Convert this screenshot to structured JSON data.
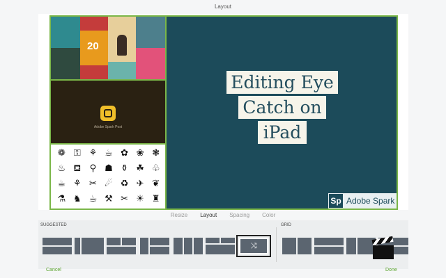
{
  "header": {
    "title": "Layout"
  },
  "canvas": {
    "collage_top": {
      "tiles": [
        {
          "text": "",
          "color": "#2f8a8f"
        },
        {
          "text": "",
          "color": "#c43c3b"
        },
        {
          "text": "",
          "color": "#4d7f8c"
        },
        {
          "text": "20",
          "color": "#e89a1d"
        },
        {
          "text": "",
          "color": "#e7cf9b"
        },
        {
          "text": "",
          "color": "#6bb3ab"
        },
        {
          "text": "",
          "color": "#2f4a3f"
        },
        {
          "text": "",
          "color": "#e2527a"
        }
      ]
    },
    "post_cell": {
      "label": "Adobe Spark Post"
    },
    "icon_cell": {
      "icons": [
        "❁",
        "⚿",
        "⚘",
        "☕",
        "✿",
        "❀",
        "❃",
        "♨",
        "⛾",
        "⚲",
        "☗",
        "⚱",
        "☘",
        "♧",
        "☕",
        "⚘",
        "✂",
        "☄",
        "♻",
        "✈",
        "❦",
        "⚗",
        "♞",
        "☕",
        "⚒",
        "✂",
        "☀",
        "♜"
      ]
    },
    "headline": {
      "line1": "Editing Eye",
      "line2": "Catch on",
      "line3": "iPad"
    },
    "brand": {
      "mark": "Sp",
      "name": "Adobe Spark"
    }
  },
  "tabs": [
    {
      "label": "Resize",
      "active": false
    },
    {
      "label": "Layout",
      "active": true
    },
    {
      "label": "Spacing",
      "active": false
    },
    {
      "label": "Color",
      "active": false
    }
  ],
  "tray": {
    "suggested_label": "SUGGESTED",
    "grid_label": "GRID",
    "selected_icon": "shuffle-icon",
    "selected_glyph": "⤨"
  },
  "footer": {
    "cancel_label": "Cancel",
    "done_label": "Done"
  },
  "colors": {
    "accent": "#7ab648",
    "canvas_bg": "#1c4b5a",
    "action": "#5aa42e"
  }
}
